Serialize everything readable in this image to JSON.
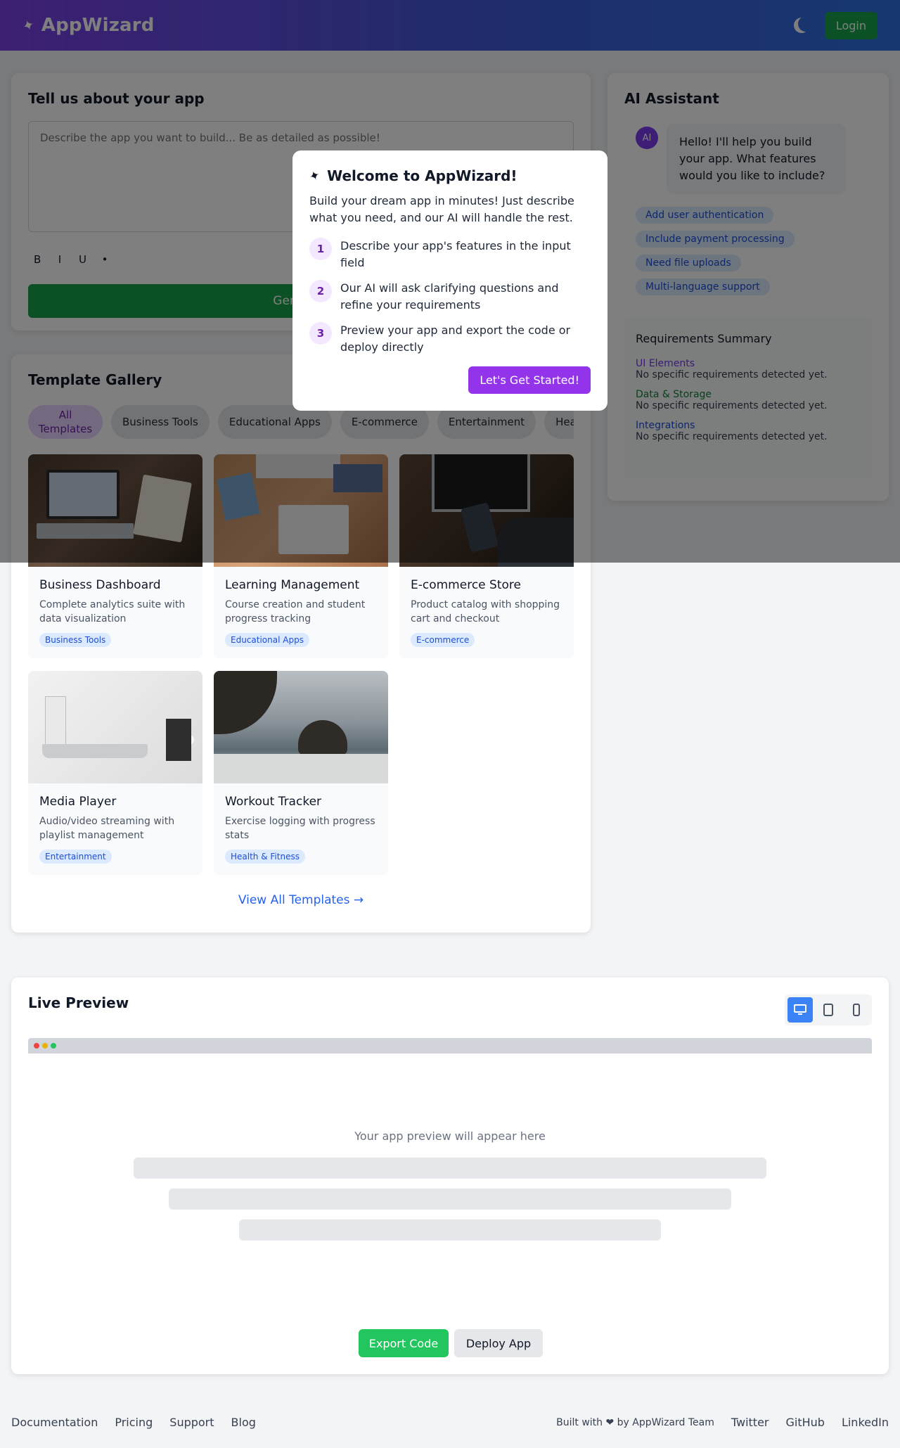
{
  "header": {
    "brand": "AppWizard",
    "brand_icon": "wand-icon",
    "login_label": "Login"
  },
  "tell": {
    "title": "Tell us about your app",
    "placeholder": "Describe the app you want to build... Be as detailed as possible!",
    "format": [
      "B",
      "I",
      "U",
      "•"
    ],
    "generate_label": "Generate"
  },
  "gallery": {
    "title": "Template Gallery",
    "chips": [
      "All Templates",
      "Business Tools",
      "Educational Apps",
      "E-commerce",
      "Entertainment",
      "Health & Fitness"
    ],
    "cards": [
      {
        "title": "Business Dashboard",
        "desc": "Complete analytics suite with data visualization",
        "badge": "Business Tools"
      },
      {
        "title": "Learning Management",
        "desc": "Course creation and student progress tracking",
        "badge": "Educational Apps"
      },
      {
        "title": "E-commerce Store",
        "desc": "Product catalog with shopping cart and checkout",
        "badge": "E-commerce"
      },
      {
        "title": "Media Player",
        "desc": "Audio/video streaming with playlist management",
        "badge": "Entertainment"
      },
      {
        "title": "Workout Tracker",
        "desc": "Exercise logging with progress stats",
        "badge": "Health & Fitness"
      }
    ],
    "view_all": "View All Templates →"
  },
  "assistant": {
    "title": "AI Assistant",
    "avatar": "AI",
    "message": "Hello! I'll help you build your app. What features would you like to include?",
    "suggestions": [
      "Add user authentication",
      "Include payment processing",
      "Need file uploads",
      "Multi-language support"
    ],
    "summary": {
      "title": "Requirements Summary",
      "sections": [
        {
          "label": "UI Elements",
          "text": "No specific requirements detected yet.",
          "color": "#7c3aed"
        },
        {
          "label": "Data & Storage",
          "text": "No specific requirements detected yet.",
          "color": "#15803d"
        },
        {
          "label": "Integrations",
          "text": "No specific requirements detected yet.",
          "color": "#1d4ed8"
        }
      ]
    }
  },
  "modal": {
    "title": "Welcome to AppWizard!",
    "intro": "Build your dream app in minutes! Just describe what you need, and our AI will handle the rest.",
    "steps": [
      {
        "num": "1",
        "text": "Describe your app's features in the input field"
      },
      {
        "num": "2",
        "text": "Our AI will ask clarifying questions and refine your requirements"
      },
      {
        "num": "3",
        "text": "Preview your app and export the code or deploy directly"
      }
    ],
    "cta": "Let's Get Started!"
  },
  "preview": {
    "title": "Live Preview",
    "placeholder": "Your app preview will appear here",
    "export_label": "Export Code",
    "deploy_label": "Deploy App"
  },
  "footer": {
    "links": [
      "Documentation",
      "Pricing",
      "Support",
      "Blog"
    ],
    "built": "Built with ❤ by AppWizard Team",
    "social": [
      "Twitter",
      "GitHub",
      "LinkedIn"
    ]
  },
  "colors": {
    "accent_purple": "#9333ea",
    "primary_green": "#16a34a",
    "link_blue": "#2563eb"
  }
}
